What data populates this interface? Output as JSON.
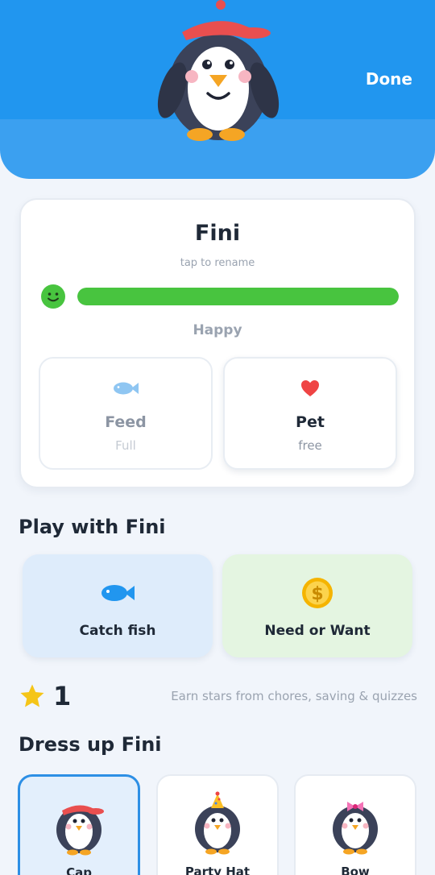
{
  "header": {
    "done_label": "Done"
  },
  "pet": {
    "name": "Fini",
    "rename_hint": "tap to rename",
    "mood": "Happy",
    "mood_level": 1.0,
    "mood_icon": "smiley-face-icon"
  },
  "actions": [
    {
      "label": "Feed",
      "status": "Full",
      "icon": "fish-icon"
    },
    {
      "label": "Pet",
      "status": "free",
      "icon": "heart-icon"
    }
  ],
  "play": {
    "title": "Play with Fini",
    "games": [
      {
        "label": "Catch fish",
        "icon": "fish-icon"
      },
      {
        "label": "Need or Want",
        "icon": "dollar-coin-icon"
      }
    ]
  },
  "stars": {
    "count": "1",
    "hint": "Earn stars from chores, saving & quizzes",
    "icon": "star-icon"
  },
  "dress": {
    "title": "Dress up Fini",
    "outfits": [
      {
        "label": "Cap",
        "selected": true
      },
      {
        "label": "Party Hat",
        "selected": false
      },
      {
        "label": "Bow",
        "selected": false
      }
    ]
  },
  "colors": {
    "header_blue": "#2196ef",
    "mood_green": "#48c43f",
    "selected_border": "#2d8fe5",
    "heart_red": "#ef4444",
    "star_yellow": "#f5c518"
  }
}
